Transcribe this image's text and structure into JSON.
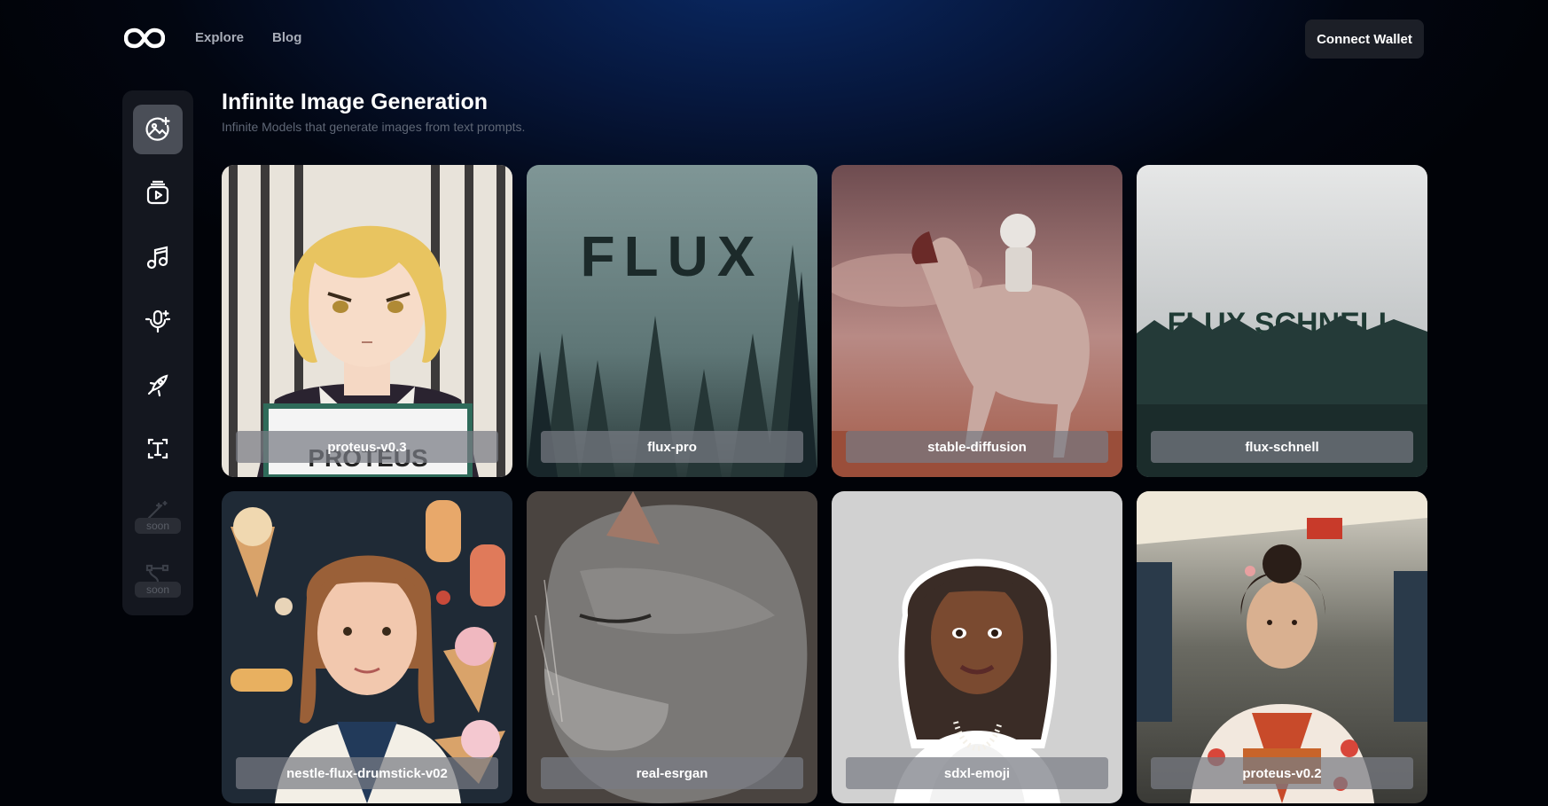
{
  "header": {
    "logo_name": "infinity-logo",
    "nav": [
      "Explore",
      "Blog"
    ],
    "connect_label": "Connect Wallet"
  },
  "sidebar": {
    "items": [
      {
        "icon": "image-generation-icon",
        "active": true
      },
      {
        "icon": "video-icon",
        "active": false
      },
      {
        "icon": "music-icon",
        "active": false
      },
      {
        "icon": "voice-icon",
        "active": false
      },
      {
        "icon": "rocket-icon",
        "active": false
      },
      {
        "icon": "text-icon",
        "active": false
      },
      {
        "icon": "magic-wand-icon",
        "badge": "soon"
      },
      {
        "icon": "vector-icon",
        "badge": "soon"
      }
    ]
  },
  "main": {
    "title": "Infinite Image Generation",
    "subtitle": "Infinite Models that generate images from text prompts."
  },
  "models": [
    {
      "label": "proteus-v0.3"
    },
    {
      "label": "flux-pro"
    },
    {
      "label": "stable-diffusion"
    },
    {
      "label": "flux-schnell"
    },
    {
      "label": "nestle-flux-drumstick-v02"
    },
    {
      "label": "real-esrgan"
    },
    {
      "label": "sdxl-emoji"
    },
    {
      "label": "proteus-v0.2"
    }
  ],
  "art_text": {
    "flux": "FLUX",
    "flux_schnell": "FLUX SCHNELL",
    "proteus_sign": "PROTEUS"
  },
  "colors": {
    "accent_bg": "#0a2a66",
    "sidebar_bg": "#14171f",
    "active_item": "#4a4e57"
  }
}
